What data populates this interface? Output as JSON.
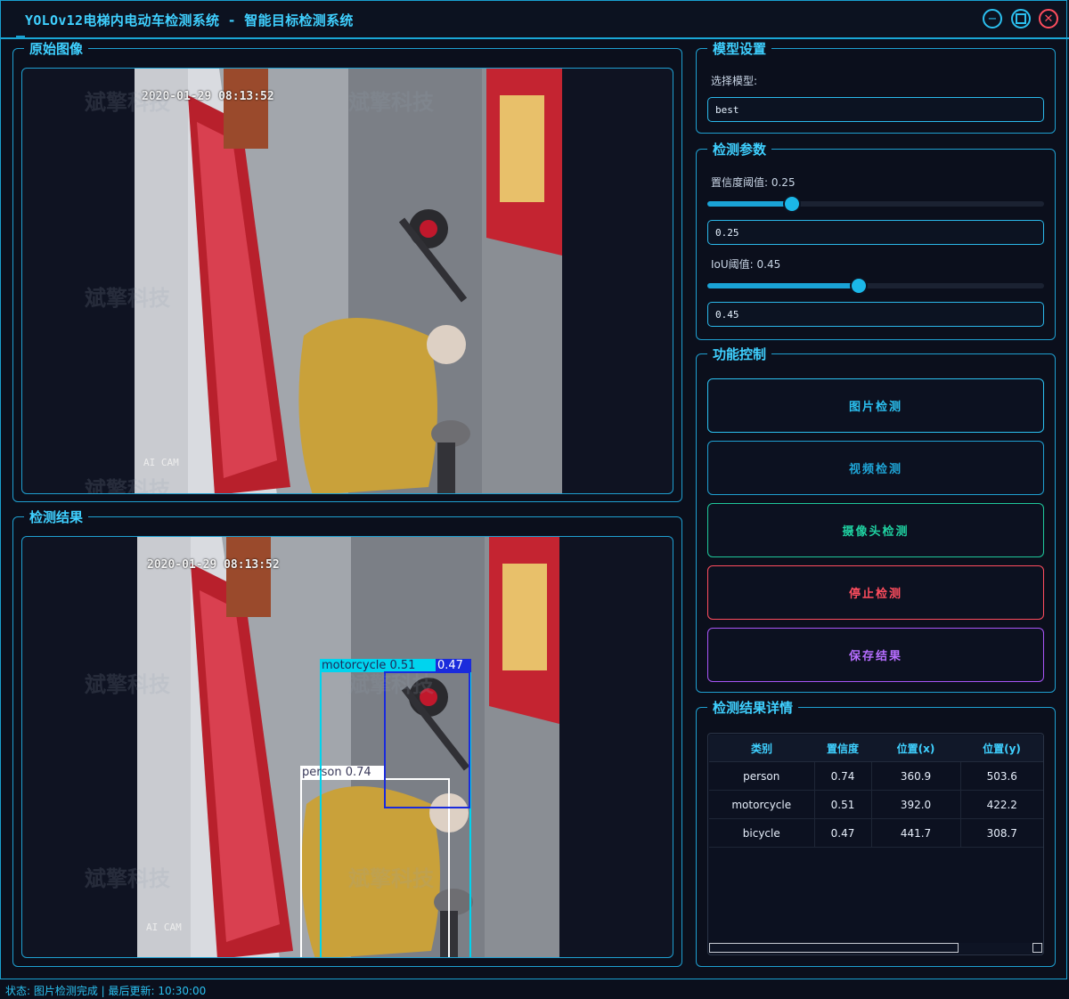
{
  "window": {
    "title": "YOLOv12电梯内电动车检测系统 - 智能目标检测系统",
    "minimize_icon": "minus-icon",
    "maximize_icon": "square-icon",
    "close_icon": "x-icon"
  },
  "original_panel": {
    "title": "原始图像",
    "timestamp": "2020-01-29 08:13:52",
    "cam_label": "AI CAM",
    "watermark": "斌擎科技"
  },
  "result_panel": {
    "title": "检测结果",
    "timestamp": "2020-01-29 08:13:52",
    "cam_label": "AI CAM",
    "watermark": "斌擎科技",
    "boxes": [
      {
        "label": "person 0.74",
        "color": "#ffffff"
      },
      {
        "label": "motorcycle 0.51",
        "color": "#00d4ee"
      },
      {
        "label": "0.47",
        "color": "#1a2bdc"
      }
    ]
  },
  "model_settings": {
    "title": "模型设置",
    "select_label": "选择模型:",
    "model_value": "best"
  },
  "params": {
    "title": "检测参数",
    "conf_label": "置信度阈值: 0.25",
    "conf_value": "0.25",
    "conf_level": 0.25,
    "iou_label": "IoU阈值: 0.45",
    "iou_value": "0.45",
    "iou_level": 0.45
  },
  "controls": {
    "title": "功能控制",
    "image_detect": "图片检测",
    "video_detect": "视频检测",
    "camera_detect": "摄像头检测",
    "stop_detect": "停止检测",
    "save_results": "保存结果"
  },
  "details": {
    "title": "检测结果详情",
    "headers": [
      "类别",
      "置信度",
      "位置(x)",
      "位置(y)"
    ],
    "rows": [
      [
        "person",
        "0.74",
        "360.9",
        "503.6"
      ],
      [
        "motorcycle",
        "0.51",
        "392.0",
        "422.2"
      ],
      [
        "bicycle",
        "0.47",
        "441.7",
        "308.7"
      ]
    ]
  },
  "status": "状态: 图片检测完成 | 最后更新: 10:30:00",
  "colors": {
    "accent": "#2bc0f0",
    "camera_button": "#1fd0a0",
    "stop_button": "#ff4d5e",
    "save_button": "#a855f7"
  }
}
